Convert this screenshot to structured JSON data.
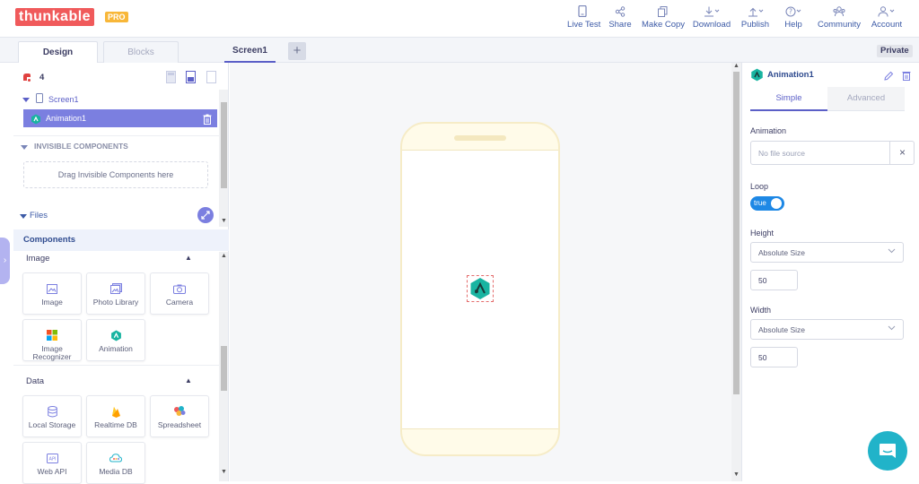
{
  "app": {
    "logo": "thunkable",
    "badge": "PRO"
  },
  "topnav": [
    {
      "label": "Live Test",
      "icon": "phone-icon"
    },
    {
      "label": "Share",
      "icon": "share-icon"
    },
    {
      "label": "Make Copy",
      "icon": "copy-icon"
    },
    {
      "label": "Download",
      "icon": "download-icon"
    },
    {
      "label": "Publish",
      "icon": "publish-icon"
    },
    {
      "label": "Help",
      "icon": "help-icon"
    },
    {
      "label": "Community",
      "icon": "community-icon"
    },
    {
      "label": "Account",
      "icon": "account-icon"
    }
  ],
  "tabs": {
    "design": "Design",
    "blocks": "Blocks",
    "screen": "Screen1",
    "add": "+",
    "privacy": "Private"
  },
  "tree": {
    "count": "4",
    "screen": "Screen1",
    "component": "Animation1",
    "invisible_header": "INVISIBLE COMPONENTS",
    "invisible_drop": "Drag Invisible Components here",
    "files": "Files"
  },
  "components": {
    "header": "Components",
    "image_category": "Image",
    "image_items": [
      "Image",
      "Photo Library",
      "Camera",
      "Image Recognizer",
      "Animation"
    ],
    "data_category": "Data",
    "data_items": [
      "Local Storage",
      "Realtime DB",
      "Spreadsheet",
      "Web API",
      "Media DB"
    ]
  },
  "properties": {
    "title": "Animation1",
    "tab_simple": "Simple",
    "tab_advanced": "Advanced",
    "animation_label": "Animation",
    "animation_placeholder": "No file source",
    "clear": "×",
    "loop_label": "Loop",
    "loop_value": "true",
    "height_label": "Height",
    "height_mode": "Absolute Size",
    "height_value": "50",
    "width_label": "Width",
    "width_mode": "Absolute Size",
    "width_value": "50"
  },
  "colors": {
    "accent": "#5b5fc7",
    "logo": "#f05a5b",
    "pro": "#f8b739",
    "selected_row": "#7b7fe0",
    "toggle": "#1e88e5",
    "chat": "#21b3c9"
  }
}
